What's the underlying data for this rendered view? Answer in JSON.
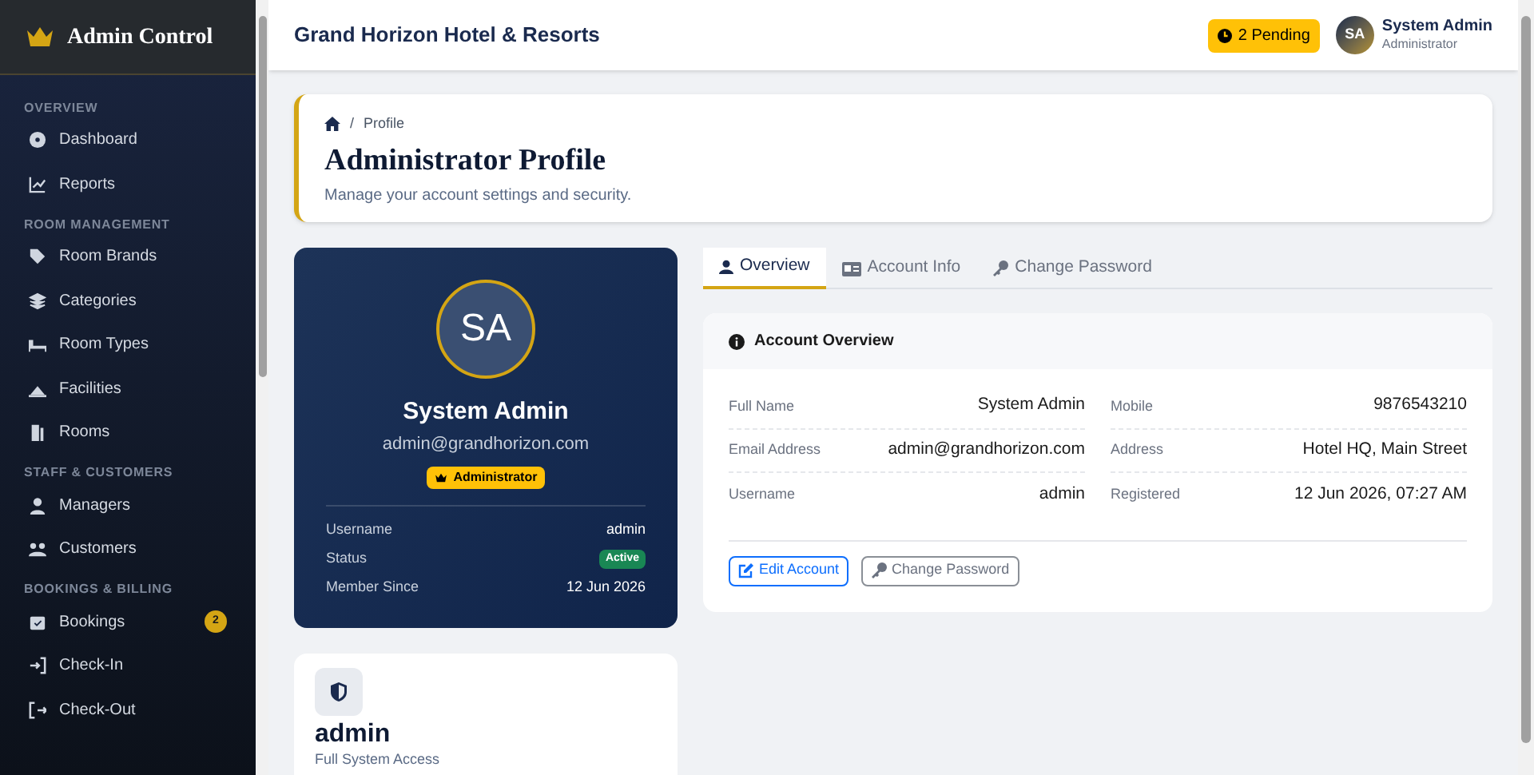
{
  "sidebar": {
    "brand": "Admin Control",
    "sections": [
      {
        "title": "OVERVIEW",
        "items": [
          {
            "label": "Dashboard",
            "selected": false
          },
          {
            "label": "Reports",
            "selected": false
          }
        ]
      },
      {
        "title": "ROOM MANAGEMENT",
        "items": [
          {
            "label": "Room Brands",
            "selected": false
          },
          {
            "label": "Categories",
            "selected": false
          },
          {
            "label": "Room Types",
            "selected": false
          },
          {
            "label": "Facilities",
            "selected": false
          },
          {
            "label": "Rooms",
            "selected": false
          }
        ]
      },
      {
        "title": "STAFF & CUSTOMERS",
        "items": [
          {
            "label": "Managers",
            "selected": false
          },
          {
            "label": "Customers",
            "selected": false
          }
        ]
      },
      {
        "title": "BOOKINGS & BILLING",
        "items": [
          {
            "label": "Bookings",
            "selected": false,
            "badge": "2"
          },
          {
            "label": "Check-In",
            "selected": false
          },
          {
            "label": "Check-Out",
            "selected": false
          }
        ]
      }
    ]
  },
  "topbar": {
    "title": "Grand Horizon Hotel & Resorts",
    "pending": "2 Pending",
    "user": {
      "initials": "SA",
      "name": "System Admin",
      "role": "Administrator"
    }
  },
  "page_header": {
    "separator": "/",
    "breadcrumb": "Profile",
    "title": "Administrator Profile",
    "subtitle": "Manage your account settings and security."
  },
  "profile_card": {
    "initials": "SA",
    "name": "System Admin",
    "email": "admin@grandhorizon.com",
    "role": "Administrator",
    "rows": [
      {
        "label": "Username",
        "value": "admin",
        "kind": "text"
      },
      {
        "label": "Status",
        "value": "Active",
        "kind": "badge"
      },
      {
        "label": "Member Since",
        "value": "12 Jun 2026",
        "kind": "text"
      }
    ]
  },
  "access_card": {
    "title": "admin",
    "subtitle": "Full System Access"
  },
  "tabs": [
    {
      "label": "Overview",
      "selected": true
    },
    {
      "label": "Account Info",
      "selected": false
    },
    {
      "label": "Change Password",
      "selected": false
    }
  ],
  "overview": {
    "title": "Account Overview",
    "fields": [
      {
        "label": "Full Name",
        "value": "System Admin"
      },
      {
        "label": "Mobile",
        "value": "9876543210"
      },
      {
        "label": "Email Address",
        "value": "admin@grandhorizon.com"
      },
      {
        "label": "Address",
        "value": "Hotel HQ, Main Street"
      },
      {
        "label": "Username",
        "value": "admin"
      },
      {
        "label": "Registered",
        "value": "12 Jun 2026, 07:27 AM"
      }
    ],
    "buttons": [
      {
        "label": "Edit Account",
        "kind": "primary"
      },
      {
        "label": "Change Password",
        "kind": "secondary"
      }
    ]
  }
}
